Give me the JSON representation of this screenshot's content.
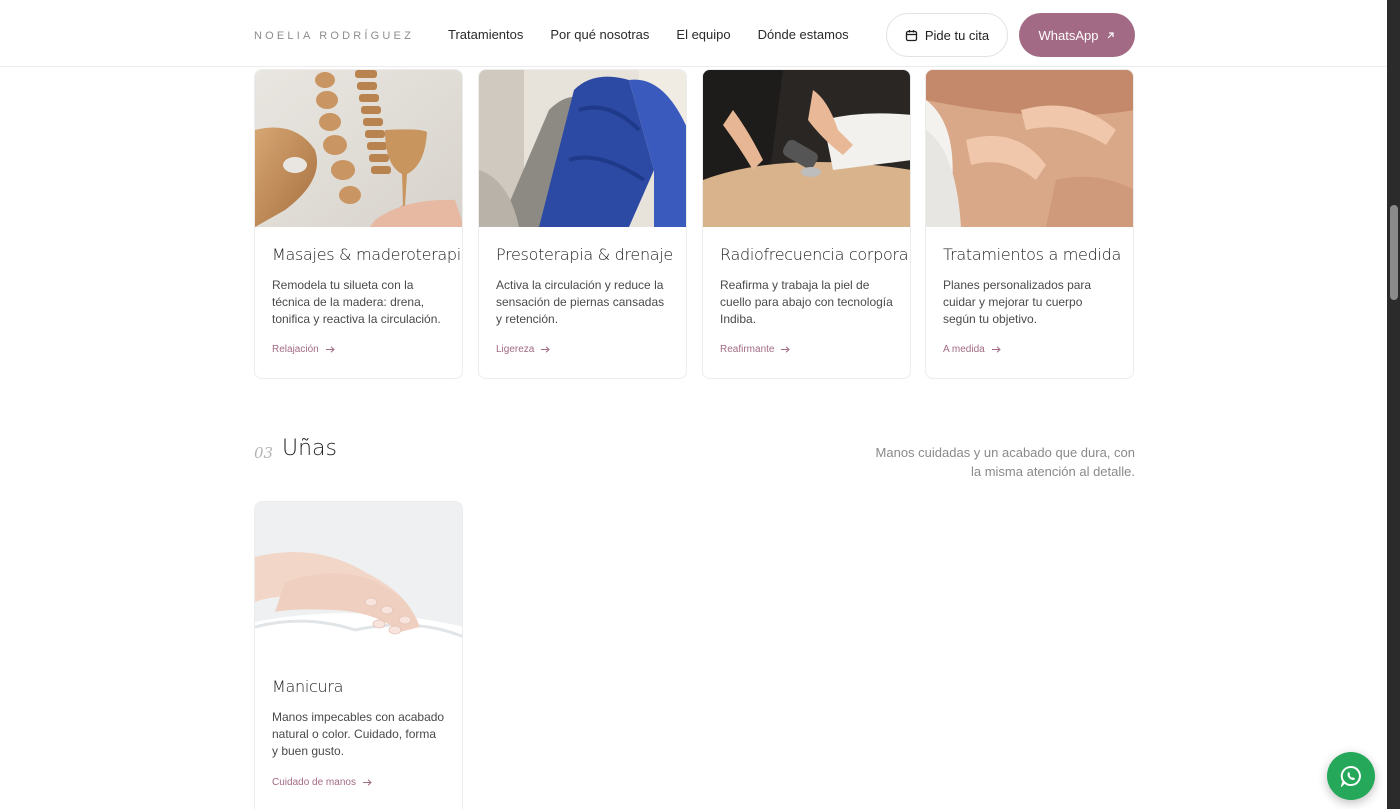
{
  "header": {
    "logo": "NOELIA RODRÍGUEZ",
    "nav": [
      "Tratamientos",
      "Por qué nosotras",
      "El equipo",
      "Dónde estamos"
    ],
    "cita_label": "Pide tu cita",
    "whatsapp_label": "WhatsApp"
  },
  "cards": [
    {
      "title": "Masajes & maderoterapia",
      "text": "Remodela tu silueta con la técnica de la madera: drena, tonifica y reactiva la circulación.",
      "tag": "Relajación"
    },
    {
      "title": "Presoterapia & drenaje",
      "text": "Activa la circulación y reduce la sensación de piernas cansadas y retención.",
      "tag": "Ligereza"
    },
    {
      "title": "Radiofrecuencia corporal",
      "text": "Reafirma y trabaja la piel de cuello para abajo con tecnología Indiba.",
      "tag": "Reafirmante"
    },
    {
      "title": "Tratamientos a medida",
      "text": "Planes personalizados para cuidar y mejorar tu cuerpo según tu objetivo.",
      "tag": "A medida"
    }
  ],
  "section": {
    "number": "03",
    "title": "Uñas",
    "description": "Manos cuidadas y un acabado que dura, con la misma atención al detalle."
  },
  "nail_card": {
    "title": "Manicura",
    "text": "Manos impecables con acabado natural o color. Cuidado, forma y buen gusto.",
    "tag": "Cuidado de manos"
  },
  "colors": {
    "accent": "#a26a84",
    "whatsapp_fab": "#25a85a"
  },
  "icons": [
    "calendar-icon",
    "arrow-up-right-icon",
    "arrow-right-icon",
    "whatsapp-icon"
  ]
}
